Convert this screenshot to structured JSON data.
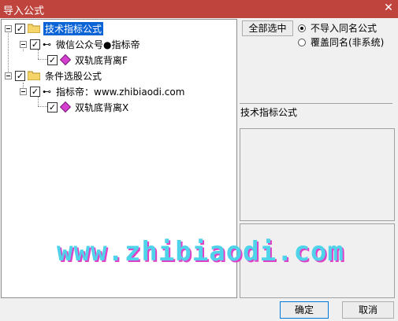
{
  "window": {
    "title": "导入公式",
    "close_glyph": "✕"
  },
  "tree": {
    "root1": {
      "label": "技术指标公式",
      "checked": true
    },
    "author1": {
      "label": "微信公众号●指标帝",
      "icon": "key-icon"
    },
    "formula1": {
      "label": "双轨底背离F",
      "icon": "diamond-icon"
    },
    "root2": {
      "label": "条件选股公式",
      "checked": true
    },
    "author2": {
      "label": "指标帝：www.zhibiaodi.com",
      "icon": "key-icon"
    },
    "formula2": {
      "label": "双轨底背离X",
      "icon": "diamond-icon"
    }
  },
  "options": {
    "select_all_label": "全部选中",
    "radio_no_import_label": "不导入同名公式",
    "radio_overwrite_label": "覆盖同名(非系统)",
    "selected": "不导入同名公式"
  },
  "info": {
    "category_label": "技术指标公式"
  },
  "footer": {
    "ok_label": "确定",
    "cancel_label": "取消"
  },
  "watermark": {
    "text": "www.zhibiaodi.com"
  },
  "colors": {
    "titlebar": "#c0443e",
    "selection": "#0a64d6",
    "diamond": "#d43fd0",
    "watermark": "#4fd3ea"
  }
}
